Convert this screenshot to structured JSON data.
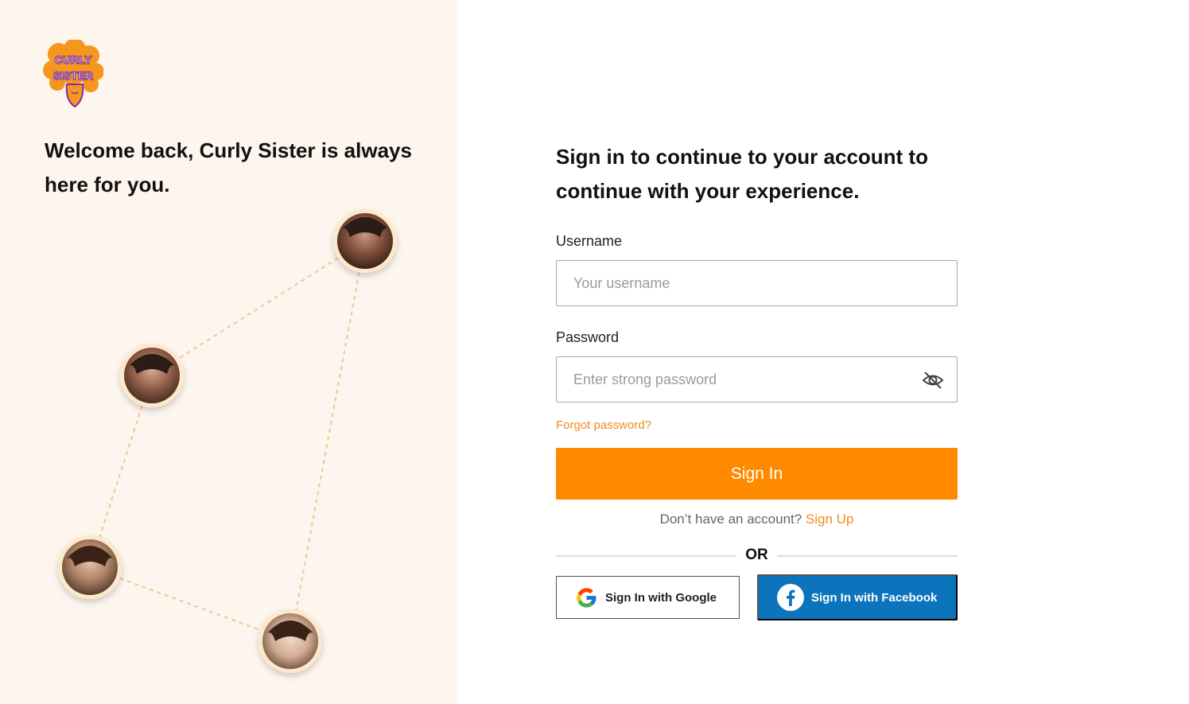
{
  "brand": {
    "logo_icon": "curly-sister-logo",
    "logo_text_line1": "CURLY",
    "logo_text_line2": "SISTER"
  },
  "left_panel": {
    "welcome_text": "Welcome back, Curly Sister is always here for you.",
    "avatars": [
      "avatar-woman-1",
      "avatar-woman-2",
      "avatar-woman-3",
      "avatar-woman-4"
    ]
  },
  "form": {
    "title": "Sign in to continue to your account to continue with your experience.",
    "username_label": "Username",
    "username_placeholder": "Your username",
    "username_value": "",
    "password_label": "Password",
    "password_placeholder": "Enter strong password",
    "password_value": "",
    "password_toggle_icon": "eye-off-icon",
    "forgot_password": "Forgot password?",
    "signin_button": "Sign In",
    "no_account_text": "Don’t have an account?",
    "signup_link": "Sign Up",
    "or_text": "OR",
    "google_button": "Sign In with Google",
    "facebook_button": "Sign In with Facebook"
  },
  "colors": {
    "accent": "#ff8a00",
    "link": "#f08a20",
    "panel_bg": "#fdf5ee",
    "facebook": "#0b74bd",
    "logo_purple": "#7b2fa8"
  }
}
